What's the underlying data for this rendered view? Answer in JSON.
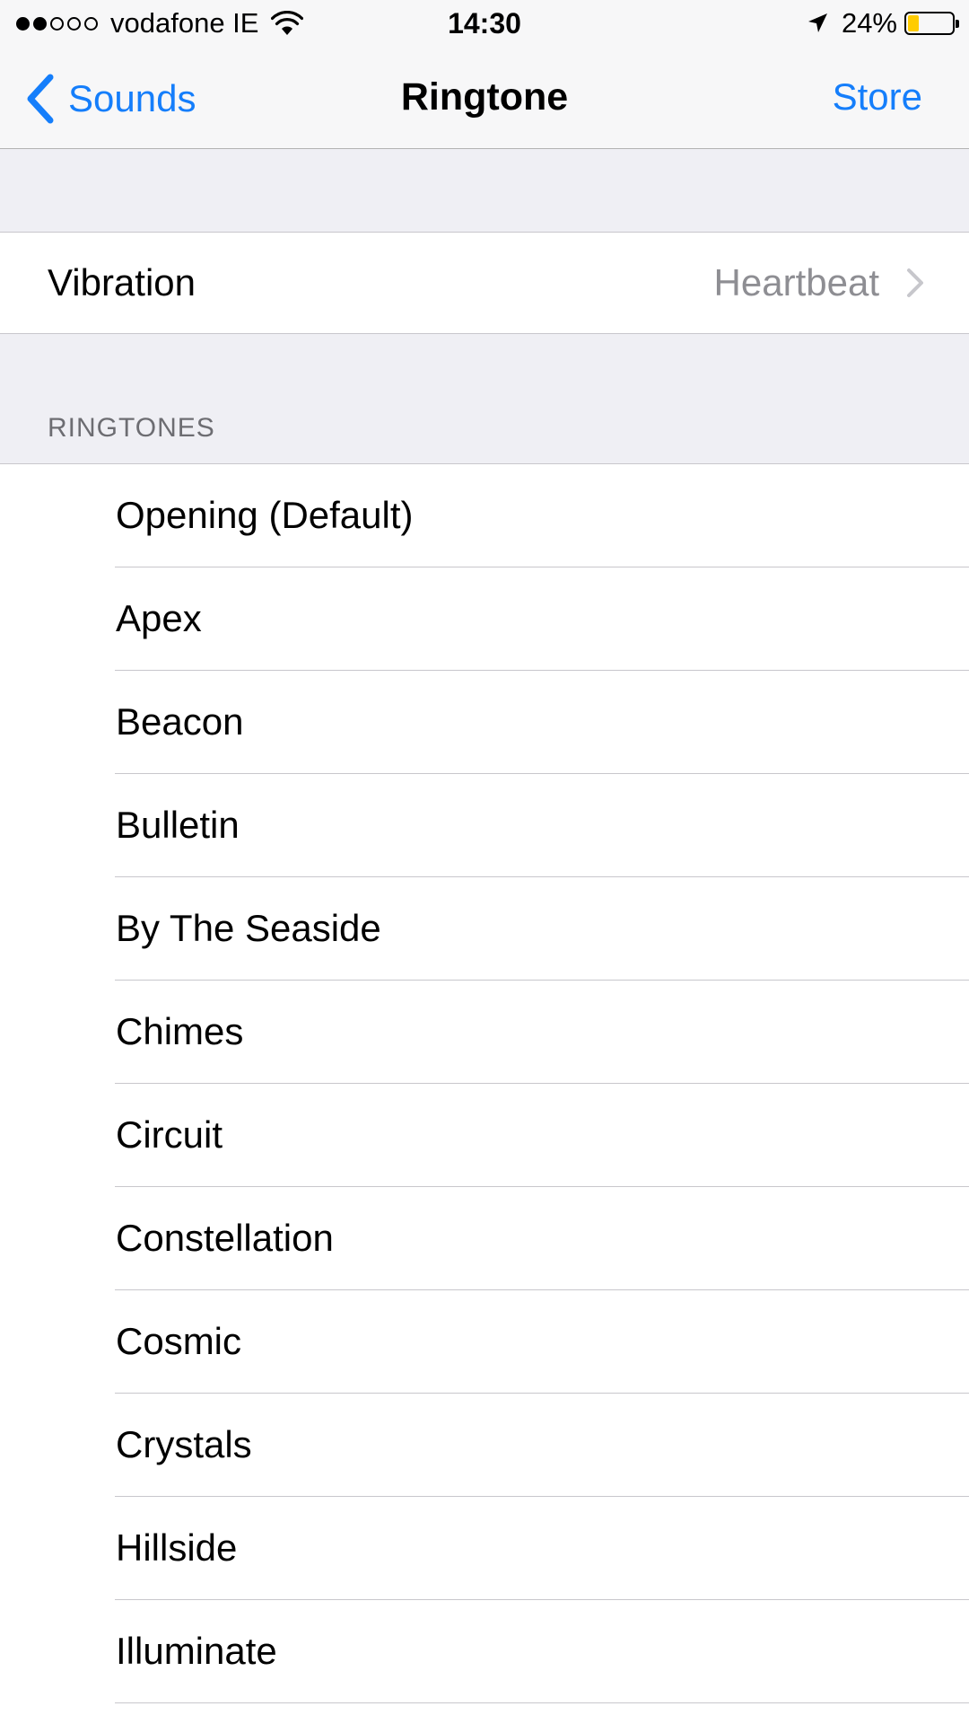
{
  "colors": {
    "accent": "#157efb",
    "battery_fill": "#ffcc00",
    "secondary_text": "#8e8e93"
  },
  "status_bar": {
    "carrier": "vodafone IE",
    "signal_bars_filled": 2,
    "signal_bars_total": 5,
    "time": "14:30",
    "battery_percent": "24%",
    "battery_level": 0.24
  },
  "nav": {
    "back_label": "Sounds",
    "title": "Ringtone",
    "right_label": "Store"
  },
  "vibration": {
    "label": "Vibration",
    "value": "Heartbeat"
  },
  "ringtones": {
    "header": "RINGTONES",
    "items": [
      "Opening (Default)",
      "Apex",
      "Beacon",
      "Bulletin",
      "By The Seaside",
      "Chimes",
      "Circuit",
      "Constellation",
      "Cosmic",
      "Crystals",
      "Hillside",
      "Illuminate"
    ]
  }
}
